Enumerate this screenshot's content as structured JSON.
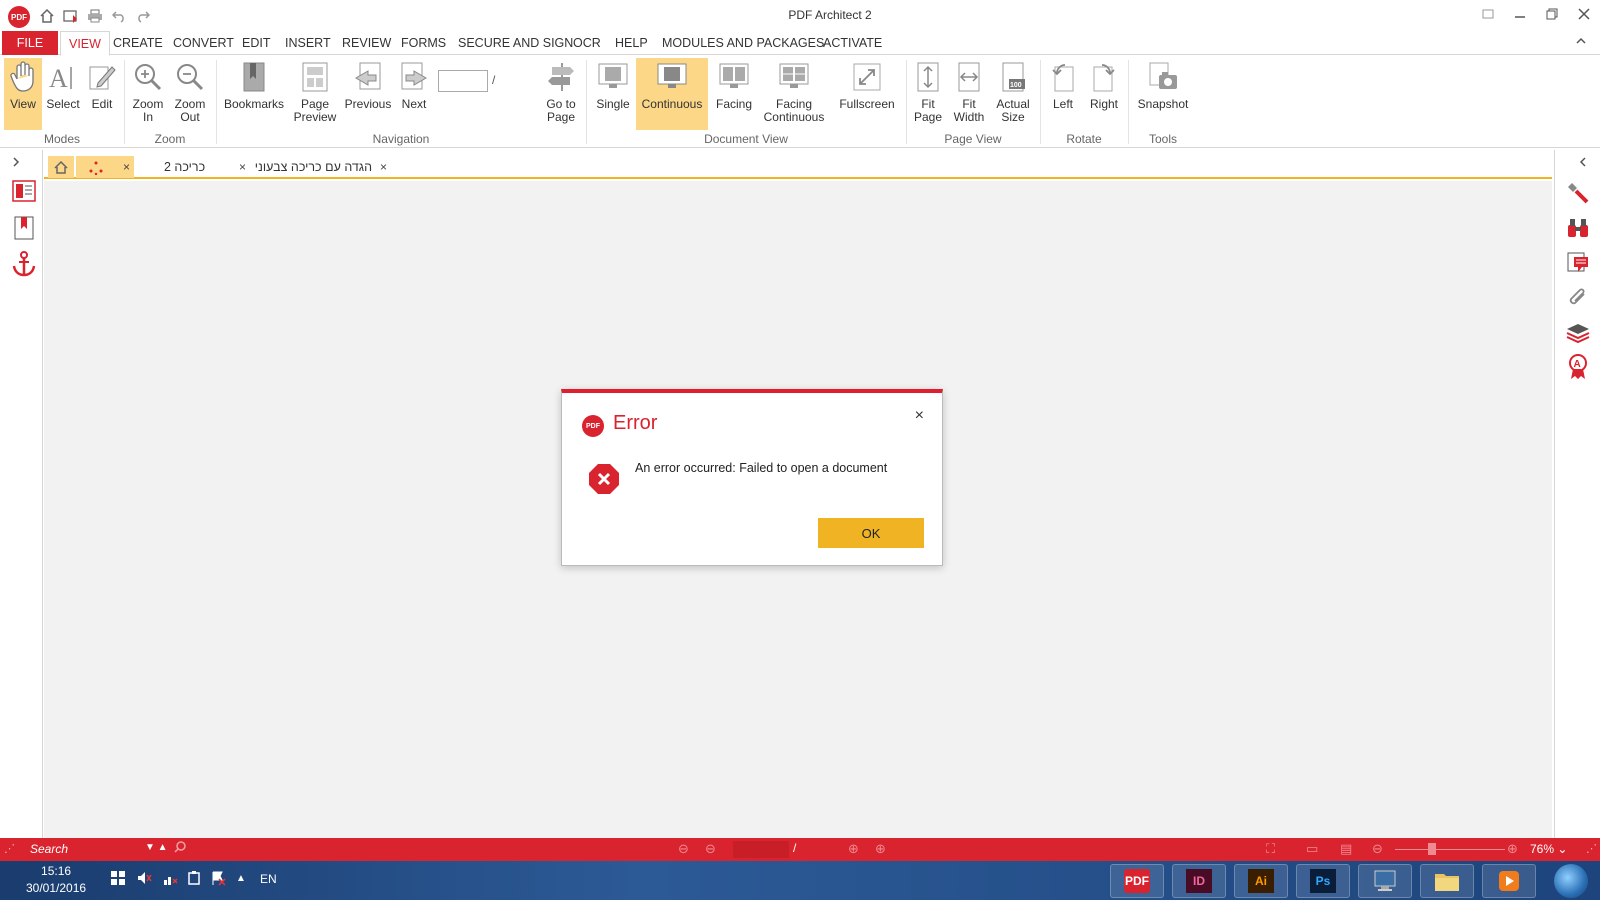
{
  "window": {
    "title": "PDF Architect 2",
    "logo_text": "PDF"
  },
  "menu": {
    "items": [
      "FILE",
      "VIEW",
      "CREATE",
      "CONVERT",
      "EDIT",
      "INSERT",
      "REVIEW",
      "FORMS",
      "SECURE AND SIGN",
      "OCR",
      "HELP",
      "MODULES AND PACKAGES",
      "ACTIVATE"
    ],
    "active": "VIEW"
  },
  "ribbon": {
    "buttons": {
      "view": [
        "View"
      ],
      "select": [
        "Select"
      ],
      "edit": [
        "Edit"
      ],
      "zoom_in": [
        "Zoom",
        "In"
      ],
      "zoom_out": [
        "Zoom",
        "Out"
      ],
      "bookmarks": [
        "Bookmarks"
      ],
      "page_preview": [
        "Page",
        "Preview"
      ],
      "previous": [
        "Previous"
      ],
      "next": [
        "Next"
      ],
      "go_to_page": [
        "Go to",
        "Page"
      ],
      "single": [
        "Single"
      ],
      "continuous": [
        "Continuous"
      ],
      "facing": [
        "Facing"
      ],
      "facing_continuous": [
        "Facing",
        "Continuous"
      ],
      "fullscreen": [
        "Fullscreen"
      ],
      "fit_page": [
        "Fit",
        "Page"
      ],
      "fit_width": [
        "Fit",
        "Width"
      ],
      "actual_size": [
        "Actual",
        "Size"
      ],
      "left": [
        "Left"
      ],
      "right": [
        "Right"
      ],
      "snapshot": [
        "Snapshot"
      ]
    },
    "groups": {
      "modes": "Modes",
      "zoom": "Zoom",
      "navigation": "Navigation",
      "document_view": "Document View",
      "page_view": "Page View",
      "rotate": "Rotate",
      "tools": "Tools"
    },
    "page_separator": "/",
    "actual_size_badge": "100"
  },
  "tabs": {
    "doc2": "כריכה 2",
    "doc3": "הגדה עם כריכה צבעוני",
    "close": "×"
  },
  "dialog": {
    "title": "Error",
    "message": "An error occurred: Failed to open a document",
    "ok_label": "OK",
    "close": "×"
  },
  "statusbar": {
    "search_label": "Search",
    "page_separator": "/",
    "zoom": "76%"
  },
  "taskbar": {
    "time": "15:16",
    "date": "30/01/2016",
    "lang": "EN",
    "apps": [
      {
        "name": "pdf-architect",
        "label": "PDF",
        "bg": "#d9232e",
        "fg": "#ffffff"
      },
      {
        "name": "indesign",
        "label": "ID",
        "bg": "#4a0c25",
        "fg": "#f068a0"
      },
      {
        "name": "illustrator",
        "label": "Ai",
        "bg": "#3a1e02",
        "fg": "#ff9a00"
      },
      {
        "name": "photoshop",
        "label": "Ps",
        "bg": "#0a1e3a",
        "fg": "#31a8ff"
      },
      {
        "name": "computer",
        "label": "",
        "bg": "#6a7b8c",
        "fg": "#ffffff"
      },
      {
        "name": "explorer",
        "label": "",
        "bg": "#e8c463",
        "fg": "#ffffff"
      },
      {
        "name": "media",
        "label": "",
        "bg": "#f07c1c",
        "fg": "#ffffff"
      }
    ]
  },
  "colors": {
    "brand_red": "#d9232e",
    "highlight": "#fcd788",
    "ok_button": "#f0b323"
  }
}
